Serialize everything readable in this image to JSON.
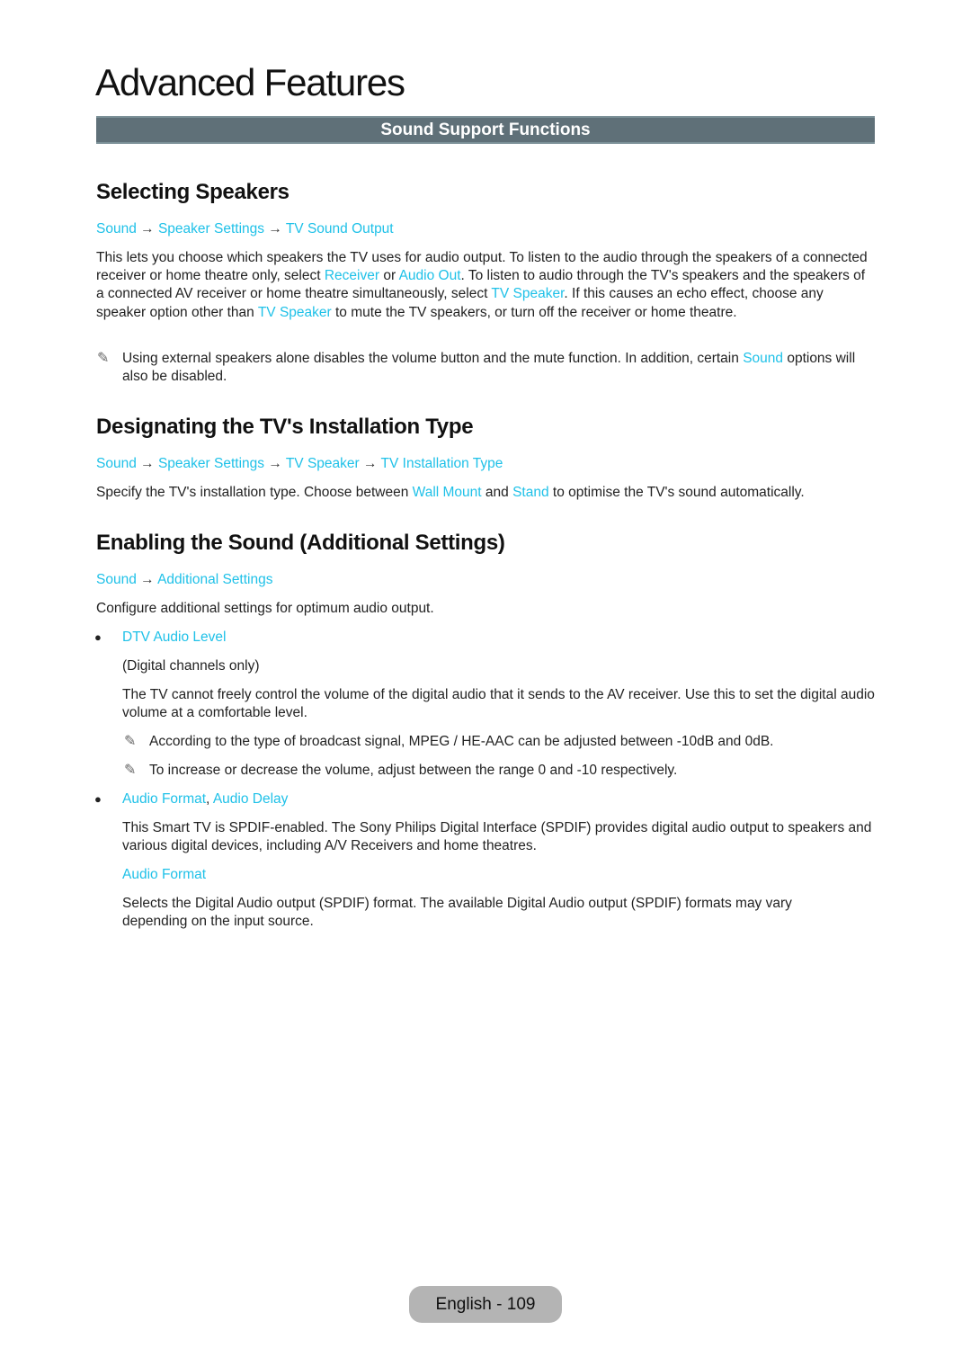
{
  "page_title": "Advanced Features",
  "section_banner": "Sound Support Functions",
  "sections": [
    {
      "heading": "Selecting Speakers",
      "path": [
        "Sound",
        "Speaker Settings",
        "TV Sound Output"
      ],
      "body": {
        "t1": "This lets you choose which speakers the TV uses for audio output. To listen to the audio through the speakers of a connected receiver or home theatre only, select ",
        "l1": "Receiver",
        "t2": " or ",
        "l2": "Audio Out",
        "t3": ". To listen to audio through the TV's speakers and the speakers of a connected AV receiver or home theatre simultaneously, select ",
        "l3": "TV Speaker",
        "t4": ". If this causes an echo effect, choose any speaker option other than ",
        "l4": "TV Speaker",
        "t5": " to mute the TV speakers, or turn off the receiver or home theatre."
      },
      "note": {
        "icon": "pencil-note-icon",
        "t1": "Using external speakers alone disables the volume button and the mute function. In addition, certain ",
        "l1": "Sound",
        "t2": " options will also be disabled."
      }
    },
    {
      "heading": "Designating the TV's Installation Type",
      "path": [
        "Sound",
        "Speaker Settings",
        "TV Speaker",
        "TV Installation Type"
      ],
      "body": {
        "t1": "Specify the TV's installation type. Choose between ",
        "l1": "Wall Mount",
        "t2": " and ",
        "l2": "Stand",
        "t3": " to optimise the TV's sound automatically."
      }
    },
    {
      "heading": "Enabling the Sound (Additional Settings)",
      "path": [
        "Sound",
        "Additional Settings"
      ],
      "intro": "Configure additional settings for optimum audio output.",
      "items": [
        {
          "label": "DTV Audio Level",
          "sub": "(Digital channels only)",
          "desc": "The TV cannot freely control the volume of the digital audio that it sends to the AV receiver. Use this to set the digital audio volume at a comfortable level.",
          "notes": [
            "According to the type of broadcast signal, MPEG / HE-AAC can be adjusted between -10dB and 0dB.",
            "To increase or decrease the volume, adjust between the range 0 and -10 respectively."
          ]
        },
        {
          "label1": "Audio Format",
          "sep": ", ",
          "label2": "Audio Delay",
          "desc": "This Smart TV is SPDIF-enabled. The Sony Philips Digital Interface (SPDIF) provides digital audio output to speakers and various digital devices, including A/V Receivers and home theatres.",
          "subheading": "Audio Format",
          "subdesc": "Selects the Digital Audio output (SPDIF) format. The available Digital Audio output (SPDIF) formats may vary depending on the input source."
        }
      ]
    }
  ],
  "arrow": "→",
  "note_glyph": "✎",
  "bullet_glyph": "●",
  "footer": "English - 109",
  "colors": {
    "link": "#1fc1e8",
    "banner": "#5f7078",
    "footer_pill": "#b4b4b4"
  }
}
